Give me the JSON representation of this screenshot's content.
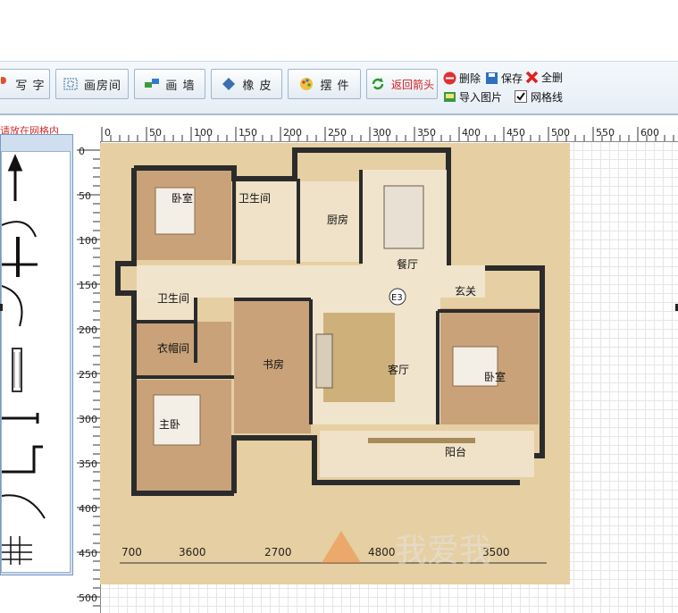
{
  "toolbar": {
    "write_label": "写 字",
    "draw_room_label": "画房间",
    "draw_wall_label": "画 墙",
    "eraser_label": "橡 皮",
    "place_label": "摆 件",
    "return_arrow_label": "返回箭头",
    "delete_label": "删除",
    "save_label": "保存",
    "delete_all_label": "全删",
    "import_image_label": "导入图片",
    "grid_lines_label": "网格线",
    "grid_lines_checked": true
  },
  "hint_text": "请放在网格内",
  "ruler": {
    "x_ticks": [
      "0",
      "50",
      "100",
      "150",
      "200",
      "250",
      "300",
      "350",
      "400",
      "450",
      "500",
      "550",
      "600"
    ],
    "y_ticks": [
      "0",
      "50",
      "100",
      "150",
      "200",
      "250",
      "300",
      "350",
      "400",
      "450",
      "500"
    ]
  },
  "floorplan": {
    "rooms": {
      "bedroom_nw": "卧室",
      "bathroom_top": "卫生间",
      "kitchen": "厨房",
      "dining": "餐厅",
      "bathroom_mid": "卫生间",
      "entry": "玄关",
      "cloakroom": "衣帽间",
      "study": "书房",
      "living": "客厅",
      "bedroom_e": "卧室",
      "master_bedroom": "主卧",
      "balcony": "阳台"
    },
    "marker": "E3",
    "dimensions": [
      "700",
      "3600",
      "2700",
      "4800",
      "3500"
    ],
    "watermark": "我爱我"
  },
  "colors": {
    "toolbar_border": "#a9bdd2",
    "hint_red": "#d03030",
    "plan_bg": "#e8d2a6",
    "wall": "#2b2b2b",
    "floor_light": "#f1e4cd",
    "wood": "#c9a27a"
  }
}
